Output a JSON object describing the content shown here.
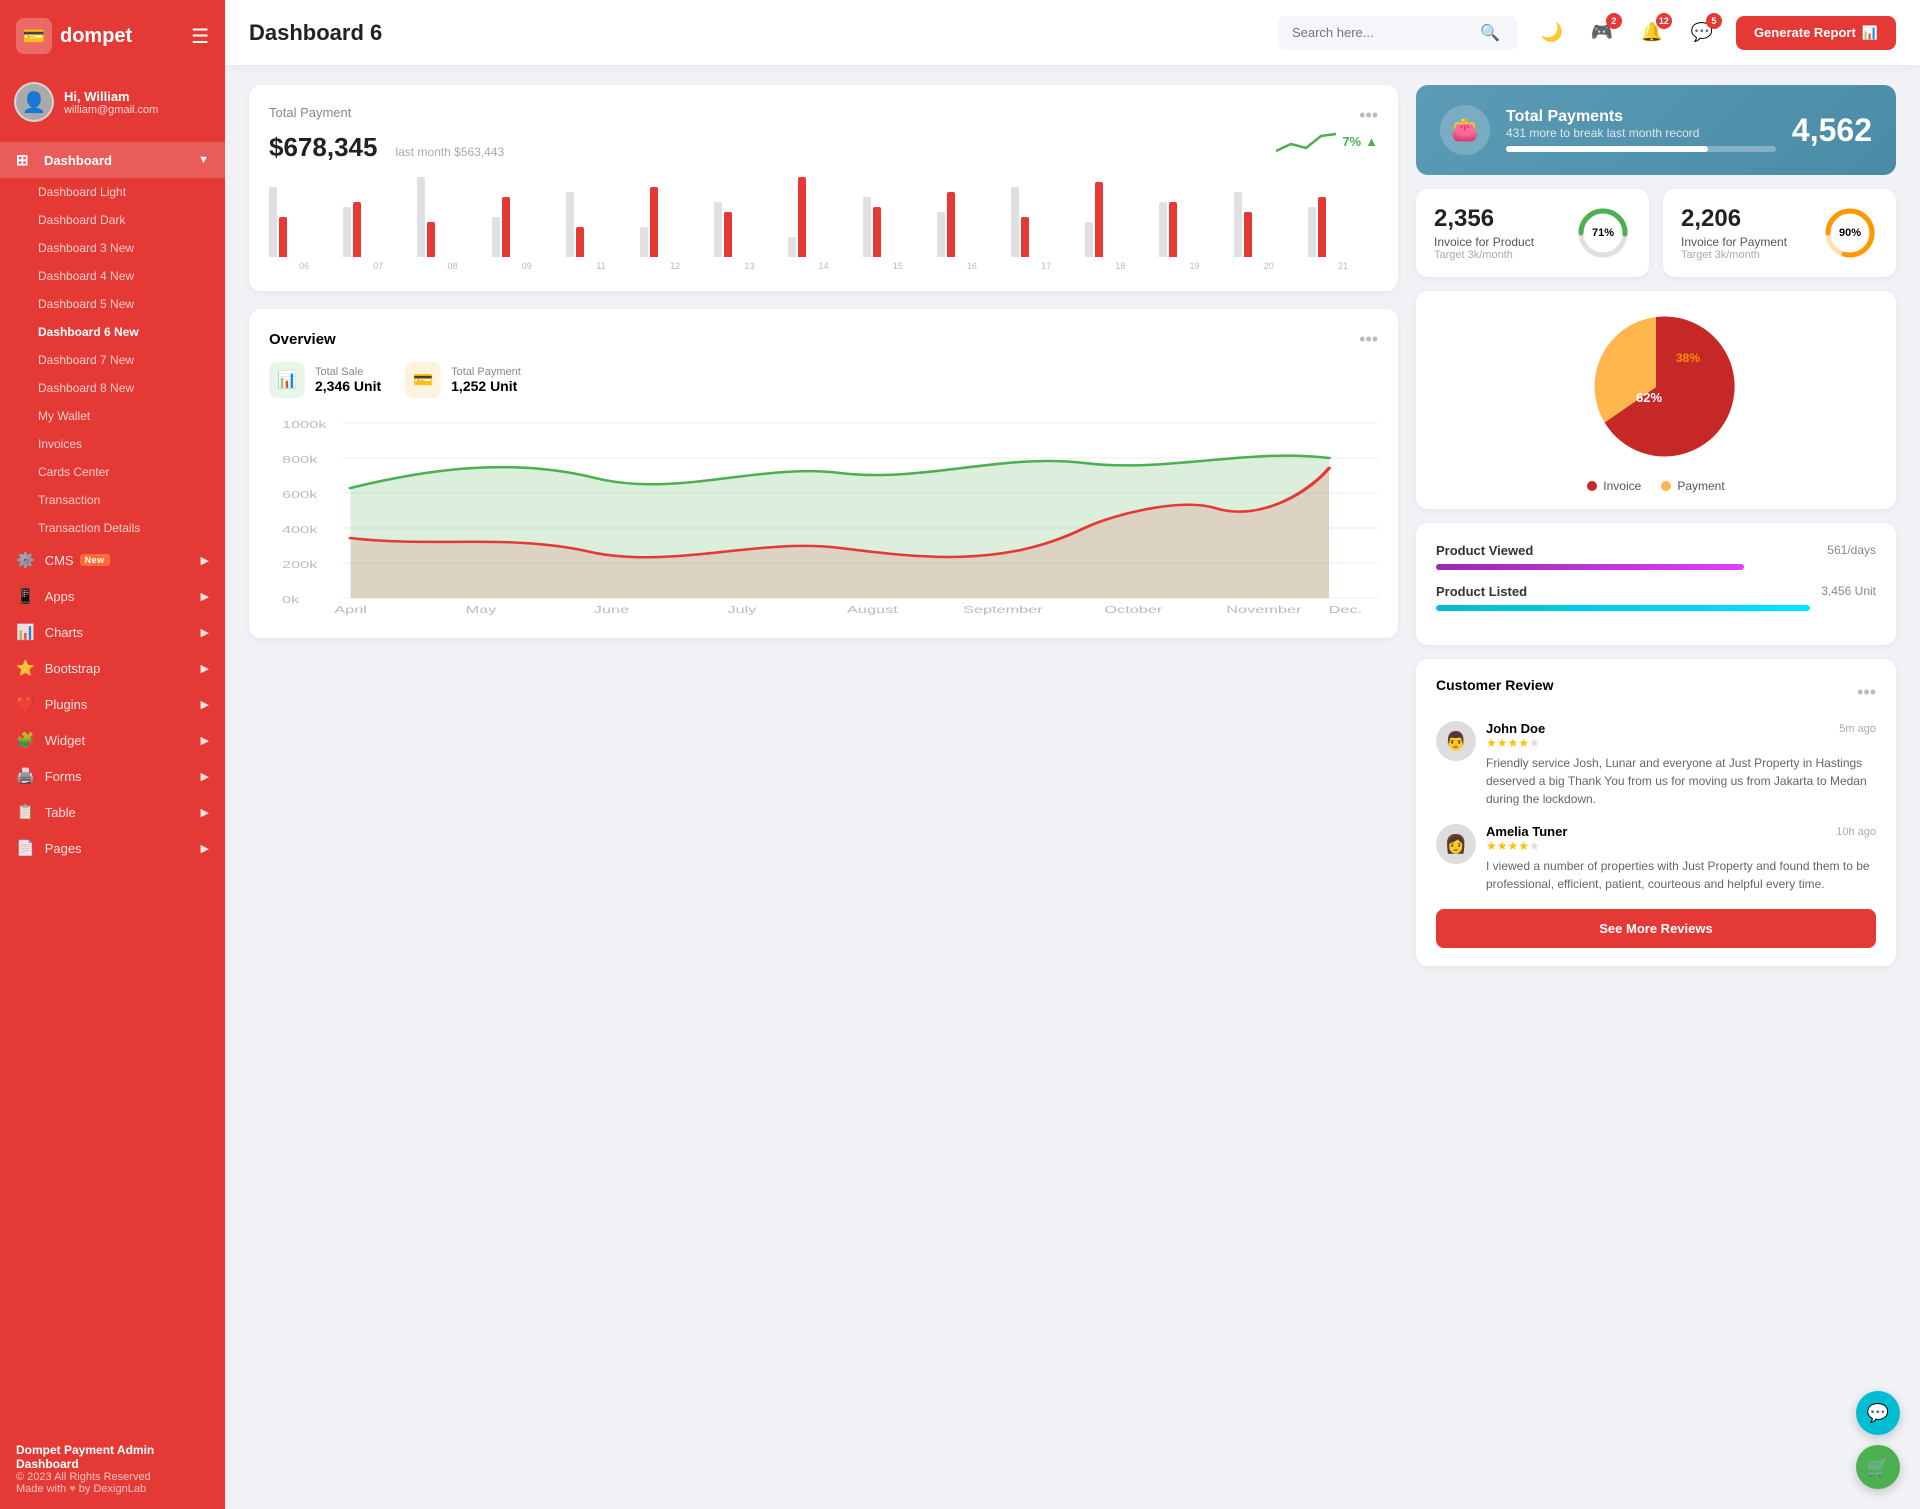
{
  "app": {
    "name": "dompet",
    "logo": "💳"
  },
  "user": {
    "greeting": "Hi, William",
    "email": "william@gmail.com",
    "avatar": "👤"
  },
  "topbar": {
    "page_title": "Dashboard 6",
    "search_placeholder": "Search here...",
    "generate_report_label": "Generate Report",
    "notifications": [
      {
        "icon": "🎮",
        "count": 2
      },
      {
        "icon": "🔔",
        "count": 12
      },
      {
        "icon": "💬",
        "count": 5
      }
    ]
  },
  "sidebar": {
    "menu_item": "Dashboard",
    "sub_items": [
      {
        "label": "Dashboard Light",
        "active": false
      },
      {
        "label": "Dashboard Dark",
        "active": false
      },
      {
        "label": "Dashboard 3",
        "badge": "New",
        "active": false
      },
      {
        "label": "Dashboard 4",
        "badge": "New",
        "active": false
      },
      {
        "label": "Dashboard 5",
        "badge": "New",
        "active": false
      },
      {
        "label": "Dashboard 6",
        "badge": "New",
        "active": true
      },
      {
        "label": "Dashboard 7",
        "badge": "New",
        "active": false
      },
      {
        "label": "Dashboard 8",
        "badge": "New",
        "active": false
      },
      {
        "label": "My Wallet",
        "active": false
      },
      {
        "label": "Invoices",
        "active": false
      },
      {
        "label": "Cards Center",
        "active": false
      },
      {
        "label": "Transaction",
        "active": false
      },
      {
        "label": "Transaction Details",
        "active": false
      }
    ],
    "nav_items": [
      {
        "label": "CMS",
        "badge": "New",
        "icon": "⚙️",
        "has_children": true
      },
      {
        "label": "Apps",
        "icon": "📱",
        "has_children": true
      },
      {
        "label": "Charts",
        "icon": "📊",
        "has_children": true
      },
      {
        "label": "Bootstrap",
        "icon": "⭐",
        "has_children": true
      },
      {
        "label": "Plugins",
        "icon": "❤️",
        "has_children": true
      },
      {
        "label": "Widget",
        "icon": "🧩",
        "has_children": true
      },
      {
        "label": "Forms",
        "icon": "🖨️",
        "has_children": true
      },
      {
        "label": "Table",
        "icon": "📋",
        "has_children": true
      },
      {
        "label": "Pages",
        "icon": "📄",
        "has_children": true
      }
    ],
    "footer": {
      "title": "Dompet Payment Admin Dashboard",
      "copyright": "© 2023 All Rights Reserved",
      "made_with": "Made with",
      "author": "by DexignLab"
    }
  },
  "total_payment": {
    "title": "Total Payment",
    "amount": "$678,345",
    "last_month_label": "last month $563,443",
    "trend_percent": "7%",
    "more_label": "...",
    "bars": [
      {
        "label": "06",
        "red": 40,
        "gray": 70
      },
      {
        "label": "07",
        "red": 55,
        "gray": 50
      },
      {
        "label": "08",
        "red": 35,
        "gray": 80
      },
      {
        "label": "09",
        "red": 60,
        "gray": 40
      },
      {
        "label": "11",
        "red": 30,
        "gray": 65
      },
      {
        "label": "12",
        "red": 70,
        "gray": 30
      },
      {
        "label": "13",
        "red": 45,
        "gray": 55
      },
      {
        "label": "14",
        "red": 80,
        "gray": 20
      },
      {
        "label": "15",
        "red": 50,
        "gray": 60
      },
      {
        "label": "16",
        "red": 65,
        "gray": 45
      },
      {
        "label": "17",
        "red": 40,
        "gray": 70
      },
      {
        "label": "18",
        "red": 75,
        "gray": 35
      },
      {
        "label": "19",
        "red": 55,
        "gray": 55
      },
      {
        "label": "20",
        "red": 45,
        "gray": 65
      },
      {
        "label": "21",
        "red": 60,
        "gray": 50
      }
    ]
  },
  "total_payments_blue": {
    "title": "Total Payments",
    "subtitle": "431 more to break last month record",
    "number": "4,562",
    "icon": "👛",
    "progress": 75
  },
  "invoice_product": {
    "number": "2,356",
    "label": "Invoice for Product",
    "target": "Target 3k/month",
    "percent": 71,
    "color": "#4caf50"
  },
  "invoice_payment": {
    "number": "2,206",
    "label": "Invoice for Payment",
    "target": "Target 3k/month",
    "percent": 90,
    "color": "#ff9800"
  },
  "overview": {
    "title": "Overview",
    "total_sale_label": "Total Sale",
    "total_sale_value": "2,346 Unit",
    "total_payment_label": "Total Payment",
    "total_payment_value": "1,252 Unit",
    "x_labels": [
      "April",
      "May",
      "June",
      "July",
      "August",
      "September",
      "October",
      "November",
      "Dec."
    ],
    "y_labels": [
      "1000k",
      "800k",
      "600k",
      "400k",
      "200k",
      "0k"
    ]
  },
  "pie_chart": {
    "invoice_percent": 62,
    "payment_percent": 38,
    "invoice_color": "#c62828",
    "payment_color": "#ffb74d",
    "legend": [
      {
        "label": "Invoice",
        "color": "#c62828"
      },
      {
        "label": "Payment",
        "color": "#ffb74d"
      }
    ]
  },
  "product_stats": [
    {
      "label": "Product Viewed",
      "value": "561/days",
      "bar_width": "70%",
      "bar_color": "purple"
    },
    {
      "label": "Product Listed",
      "value": "3,456 Unit",
      "bar_width": "85%",
      "bar_color": "teal"
    }
  ],
  "customer_review": {
    "title": "Customer Review",
    "reviews": [
      {
        "name": "John Doe",
        "time": "5m ago",
        "stars": 4,
        "text": "Friendly service Josh, Lunar and everyone at Just Property in Hastings deserved a big Thank You from us for moving us from Jakarta to Medan during the lockdown.",
        "avatar": "👨"
      },
      {
        "name": "Amelia Tuner",
        "time": "10h ago",
        "stars": 4,
        "text": "I viewed a number of properties with Just Property and found them to be professional, efficient, patient, courteous and helpful every time.",
        "avatar": "👩"
      }
    ],
    "see_more_label": "See More Reviews"
  },
  "fab_buttons": [
    {
      "icon": "💬",
      "color": "teal",
      "label": "chat-fab"
    },
    {
      "icon": "🛒",
      "color": "green",
      "label": "cart-fab"
    }
  ]
}
